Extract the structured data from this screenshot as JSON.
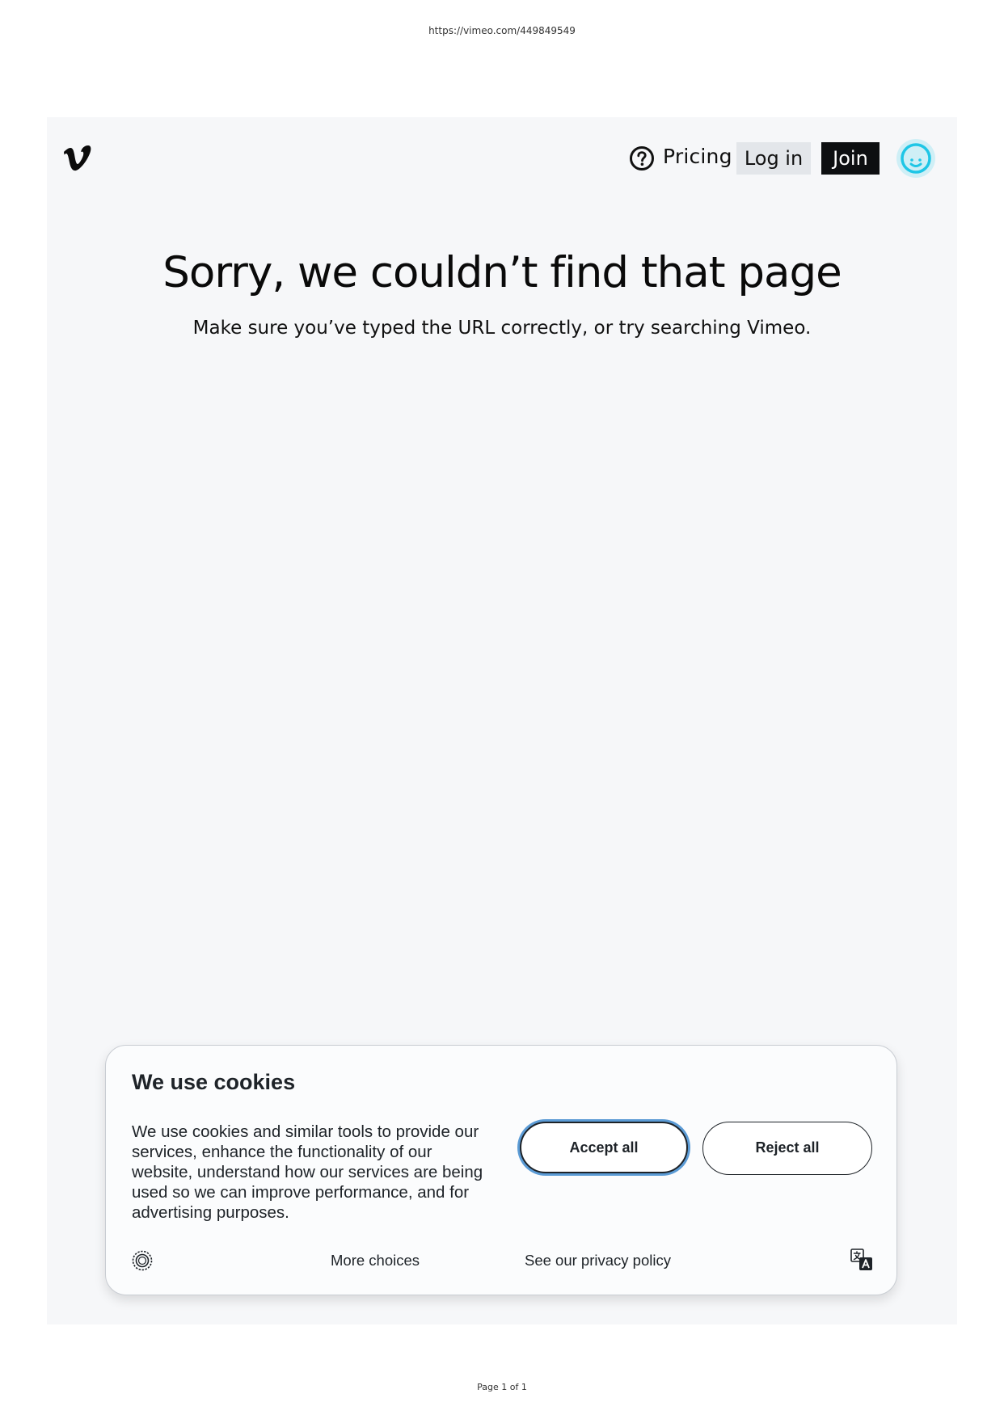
{
  "print": {
    "url": "https://vimeo.com/449849549",
    "page_label": "Page 1 of 1"
  },
  "header": {
    "logo_icon": "vimeo-logo-icon",
    "help_icon": "question-circle-icon",
    "pricing_label": "Pricing",
    "login_label": "Log in",
    "join_label": "Join",
    "avatar_icon": "smiley-avatar-icon"
  },
  "main": {
    "title": "Sorry, we couldn’t find that page",
    "subtitle": "Make sure you’ve typed the URL correctly, or try searching Vimeo."
  },
  "cookie_banner": {
    "title": "We use cookies",
    "body": "We use cookies and similar tools to provide our services, enhance the functionality of our website, understand how our services are being used so we can improve performance, and for advertising purposes.",
    "accept_label": "Accept all",
    "reject_label": "Reject all",
    "more_choices_label": "More choices",
    "privacy_label": "See our privacy policy",
    "consent_icon": "consent-badge-icon",
    "translate_icon": "translate-icon"
  },
  "colors": {
    "page_background": "#f6f7f9",
    "join_background": "#0d0f11",
    "login_background": "#e3e6ea",
    "avatar_accent": "#1fc6e6",
    "focus_ring": "#5b9bd5"
  }
}
